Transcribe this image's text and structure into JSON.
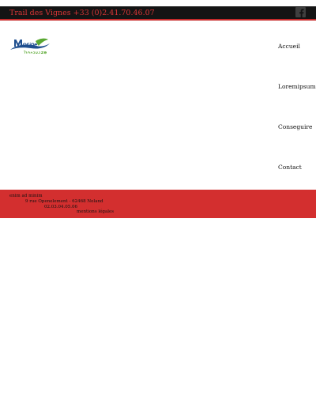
{
  "header": {
    "tagline": "Trail des Vignes +33 (0)2.41.70.46.07",
    "facebook_icon": "facebook-icon"
  },
  "logo": {
    "text_main": "Moine",
    "text_sub": "&Sanguèze",
    "colors": {
      "primary": "#1f4f8f",
      "accent": "#5aa832"
    }
  },
  "nav": {
    "items": [
      {
        "label": "Accueil"
      },
      {
        "label": "Loremipsum"
      },
      {
        "label": "Conseguire"
      },
      {
        "label": "Contact"
      }
    ]
  },
  "footer": {
    "name": "enim ad minim",
    "address": "9 rue Openelement - 62468 Noland",
    "phone": "02.03.04.05.06",
    "legal_link": "mentions légales"
  },
  "colors": {
    "topbar_bg": "#141414",
    "topbar_text": "#d93636",
    "footer_bg": "#d32f2f"
  }
}
